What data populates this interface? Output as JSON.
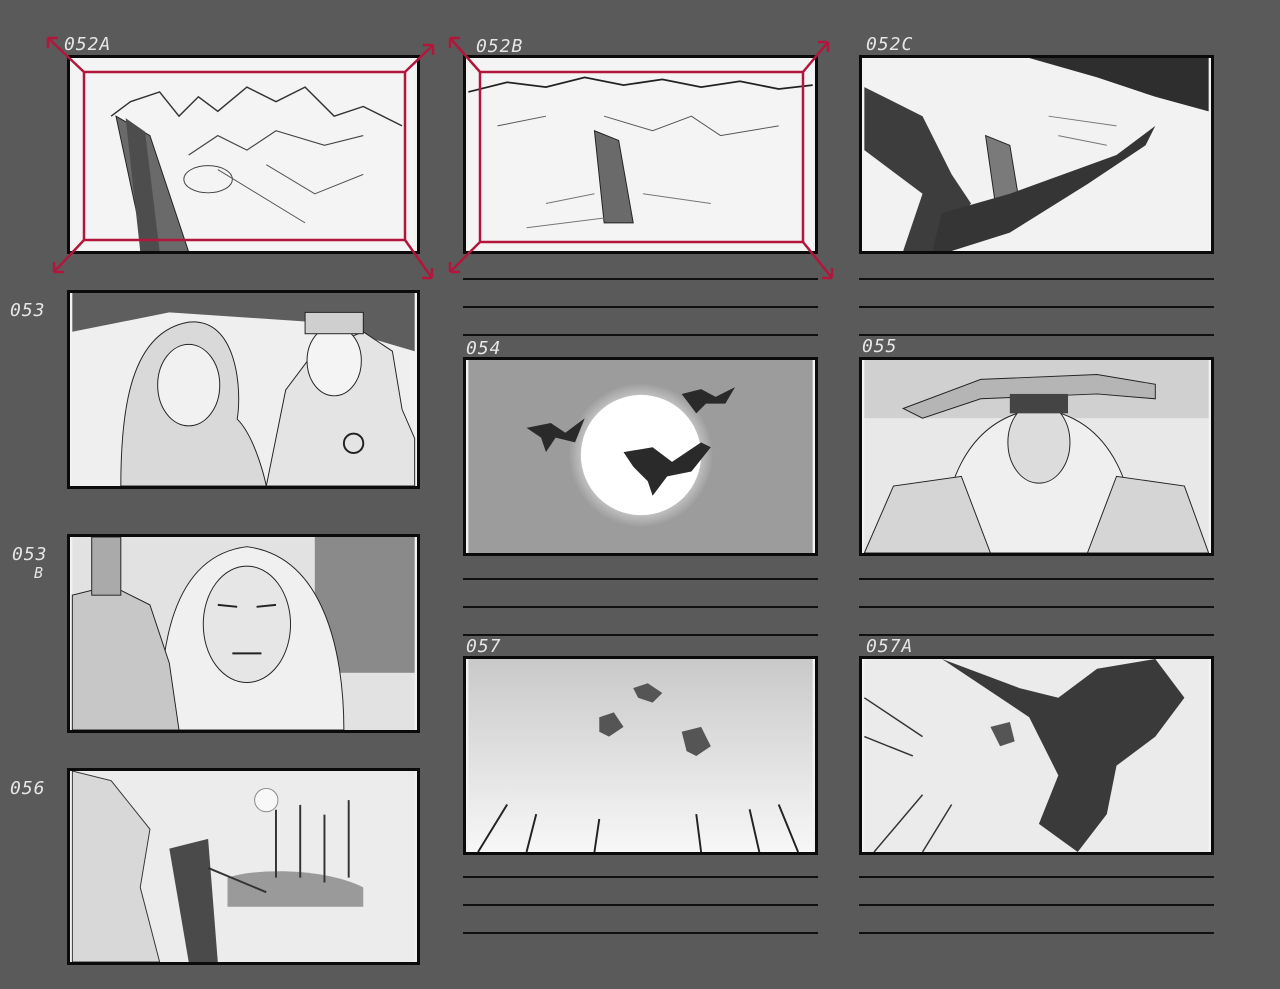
{
  "storyboard": {
    "panels": [
      {
        "id": "p052a",
        "label": "052A"
      },
      {
        "id": "p052b",
        "label": "052B"
      },
      {
        "id": "p052c",
        "label": "052C"
      },
      {
        "id": "p053",
        "label": "053"
      },
      {
        "id": "p054",
        "label": "054"
      },
      {
        "id": "p055",
        "label": "055"
      },
      {
        "id": "p053b",
        "label": "053",
        "label_suffix": "B"
      },
      {
        "id": "p057",
        "label": "057"
      },
      {
        "id": "p057a",
        "label": "057A"
      },
      {
        "id": "p056",
        "label": "056"
      }
    ],
    "colors": {
      "background": "#5a5a5a",
      "frame": "#0b0b0b",
      "camera_move": "#b3163c"
    }
  }
}
